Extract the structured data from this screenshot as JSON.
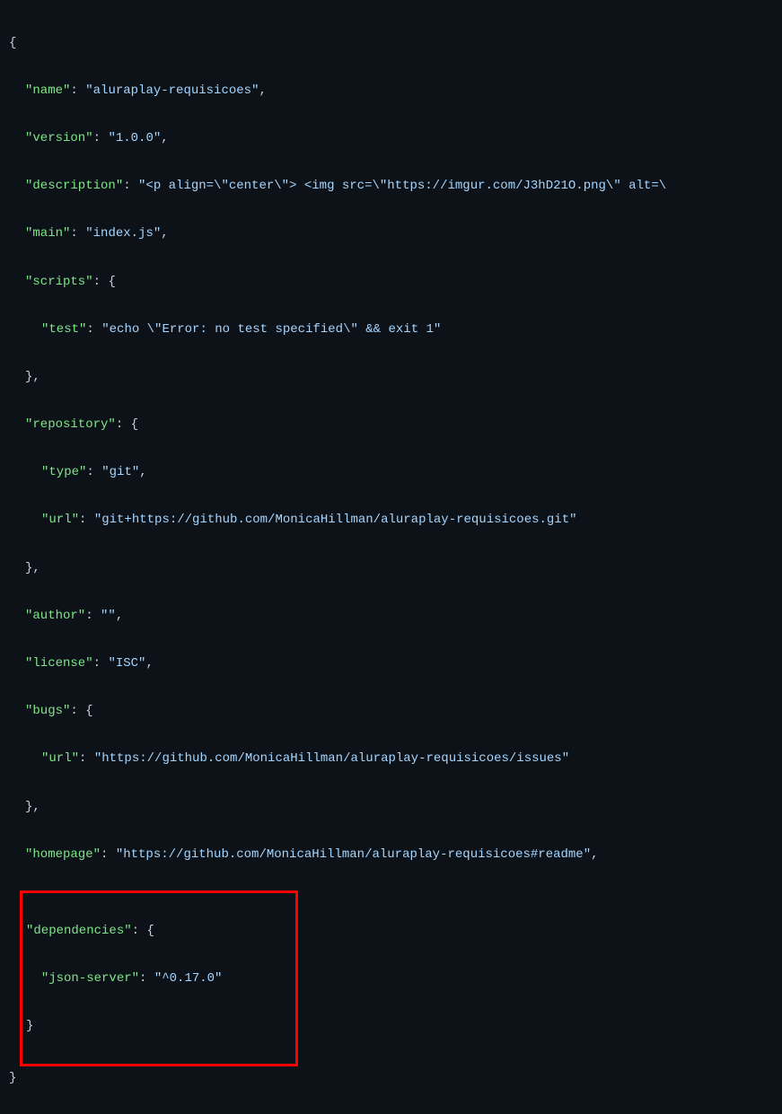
{
  "json": {
    "name_key": "\"name\"",
    "name_val": "\"aluraplay-requisicoes\"",
    "version_key": "\"version\"",
    "version_val": "\"1.0.0\"",
    "description_key": "\"description\"",
    "description_val": "\"<p align=\\\"center\\\"> <img src=\\\"https://imgur.com/J3hD21O.png\\\" alt=\\",
    "main_key": "\"main\"",
    "main_val": "\"index.js\"",
    "scripts_key": "\"scripts\"",
    "test_key": "\"test\"",
    "test_val": "\"echo \\\"Error: no test specified\\\" && exit 1\"",
    "repository_key": "\"repository\"",
    "type_key": "\"type\"",
    "type_val": "\"git\"",
    "url_key": "\"url\"",
    "repo_url_val": "\"git+https://github.com/MonicaHillman/aluraplay-requisicoes.git\"",
    "author_key": "\"author\"",
    "author_val": "\"\"",
    "license_key": "\"license\"",
    "license_val": "\"ISC\"",
    "bugs_key": "\"bugs\"",
    "bugs_url_val": "\"https://github.com/MonicaHillman/aluraplay-requisicoes/issues\"",
    "homepage_key": "\"homepage\"",
    "homepage_val": "\"https://github.com/MonicaHillman/aluraplay-requisicoes#readme\"",
    "dependencies_key": "\"dependencies\"",
    "jsonserver_key": "\"json-server\"",
    "jsonserver_val": "\"^0.17.0\""
  }
}
